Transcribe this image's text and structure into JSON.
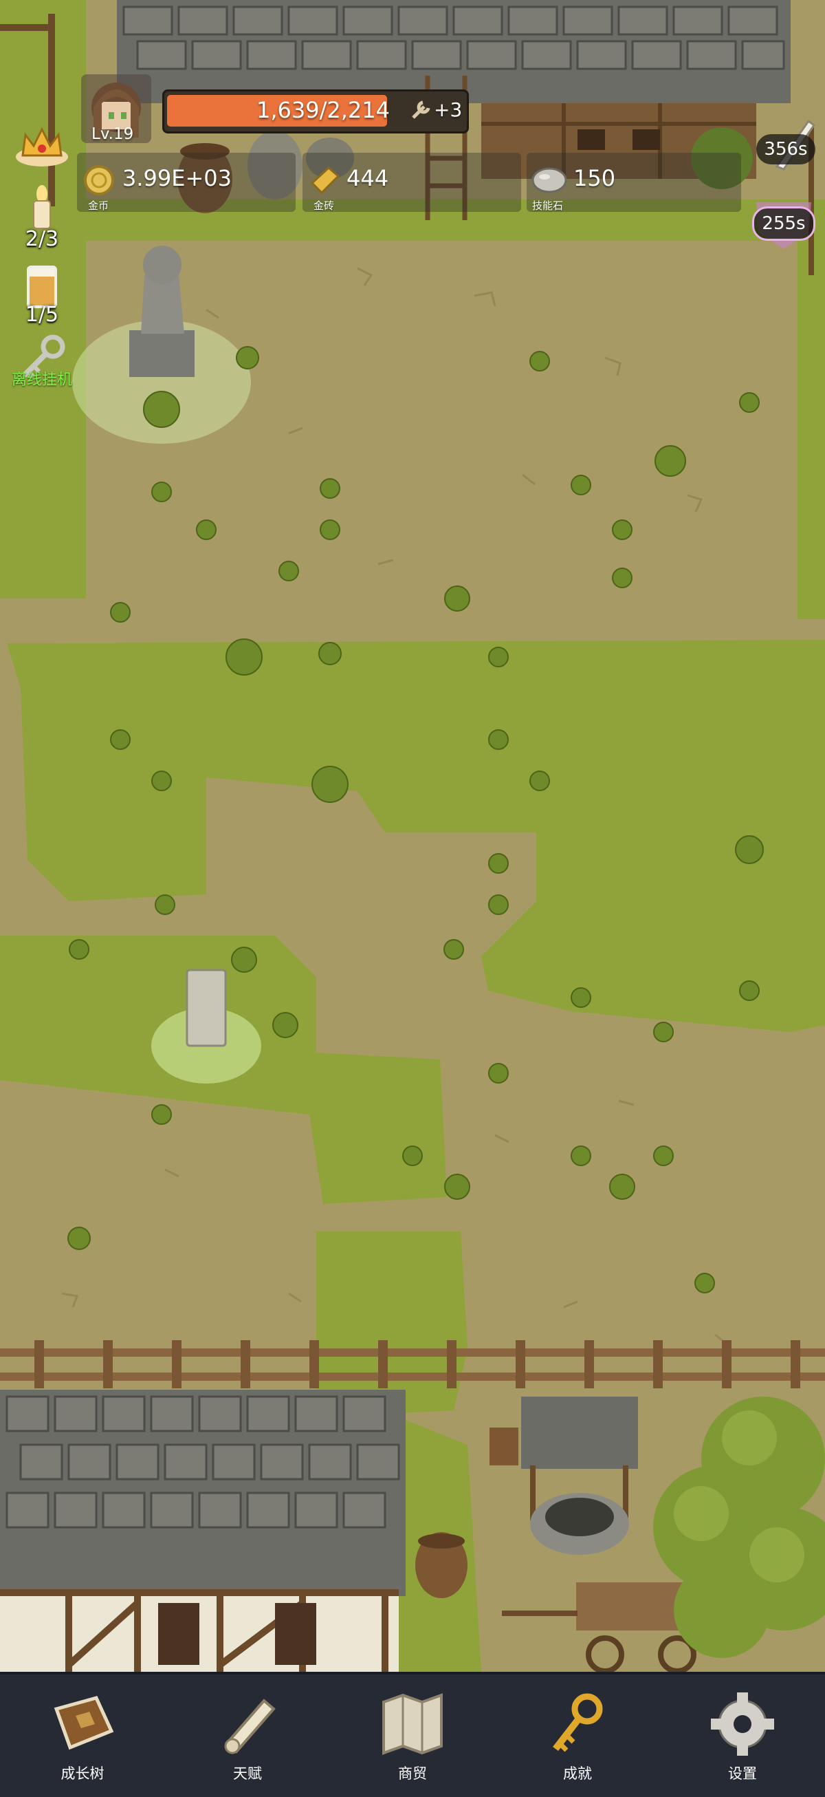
{
  "player": {
    "level_label": "Lv.19",
    "exp_text": "1,639/2,214",
    "exp_fraction": 0.74,
    "bonus_text": "+3"
  },
  "resources": {
    "gold": {
      "value": "3.99E+03",
      "label": "金币",
      "icon": "gold-coin-icon"
    },
    "gold_brick": {
      "value": "444",
      "label": "金砖",
      "icon": "gold-brick-icon"
    },
    "skill_stone": {
      "value": "150",
      "label": "技能石",
      "icon": "skill-stone-icon"
    }
  },
  "left_column": {
    "candle_count": "2/3",
    "drink_count": "1/5",
    "idle_label": "离线挂机"
  },
  "timers": {
    "top": "356s",
    "bottom": "255s"
  },
  "nav": [
    {
      "label": "成长树",
      "icon": "book-icon"
    },
    {
      "label": "天赋",
      "icon": "scroll-icon"
    },
    {
      "label": "商贸",
      "icon": "map-icon"
    },
    {
      "label": "成就",
      "icon": "golden-key-icon"
    },
    {
      "label": "设置",
      "icon": "gear-icon"
    }
  ],
  "colors": {
    "dirt": "#a89a64",
    "grass": "#8fa33a",
    "exp_bar": "#e9733a",
    "nav_bg": "#262a35",
    "idle_label": "#7cf24a"
  }
}
